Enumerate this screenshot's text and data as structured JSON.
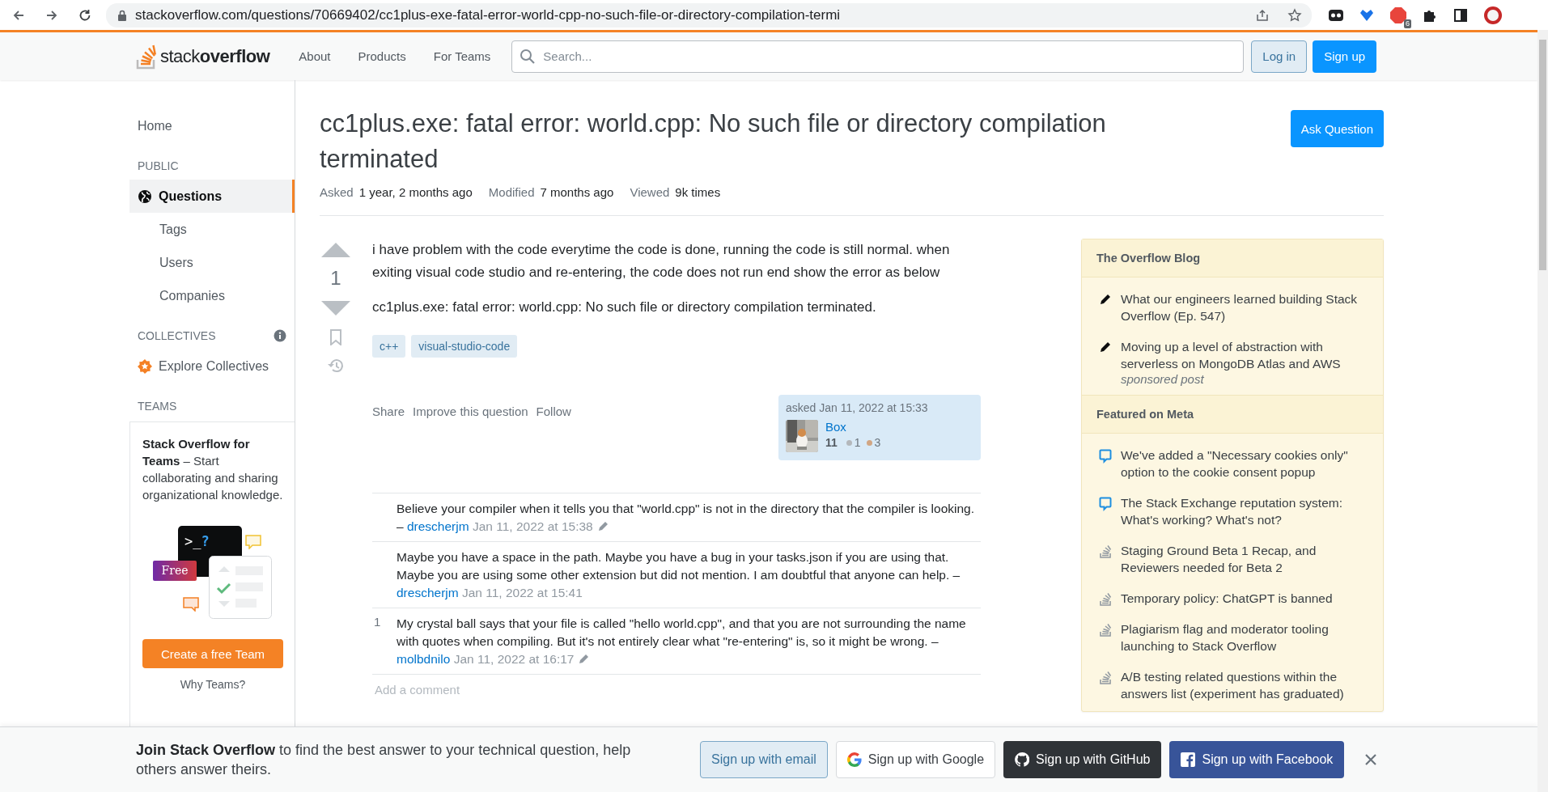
{
  "browser": {
    "url": "stackoverflow.com/questions/70669402/cc1plus-exe-fatal-error-world-cpp-no-such-file-or-directory-compilation-termi",
    "extension_badge": "6"
  },
  "header": {
    "logo": {
      "light": "stack",
      "bold": "overflow"
    },
    "nav": [
      "About",
      "Products",
      "For Teams"
    ],
    "search": {
      "placeholder": "Search..."
    },
    "buttons": [
      {
        "label": "Log in",
        "kind": "secondary"
      },
      {
        "label": "Sign up",
        "kind": "primary"
      }
    ]
  },
  "sidebar": {
    "items": [
      {
        "kind": "top",
        "label": "Home",
        "selected": false
      },
      {
        "kind": "heading",
        "label": "PUBLIC",
        "info": false
      },
      {
        "kind": "globe-link",
        "label": "Questions",
        "selected": true
      },
      {
        "kind": "sub",
        "label": "Tags",
        "selected": false
      },
      {
        "kind": "sub",
        "label": "Users",
        "selected": false
      },
      {
        "kind": "sub",
        "label": "Companies",
        "selected": false
      },
      {
        "kind": "heading",
        "label": "COLLECTIVES",
        "info": true
      },
      {
        "kind": "collective-link",
        "label": "Explore Collectives",
        "selected": false
      },
      {
        "kind": "heading",
        "label": "TEAMS",
        "info": false
      }
    ],
    "teams": {
      "text": "**Stack Overflow for Teams** – Start collaborating and sharing organizational knowledge.",
      "prompt": ">_",
      "prompt_mark": "?",
      "badge": "Free",
      "button": "Create a free Team",
      "link": "Why Teams?"
    }
  },
  "question": {
    "title": "cc1plus.exe: fatal error: world.cpp: No such file or directory compilation terminated",
    "ask_button": "Ask Question",
    "meta": [
      {
        "label": "Asked",
        "value": "1 year, 2 months ago"
      },
      {
        "label": "Modified",
        "value": "7 months ago"
      },
      {
        "label": "Viewed",
        "value": "9k times"
      }
    ],
    "votes": "1",
    "body": [
      "i have problem with the code everytime the code is done, running the code is still normal. when exiting visual code studio and re-entering, the code does not run end show the error as below",
      "cc1plus.exe: fatal error: world.cpp: No such file or directory compilation terminated."
    ],
    "tags": [
      "c++",
      "visual-studio-code"
    ],
    "actions": [
      "Share",
      "Improve this question",
      "Follow"
    ],
    "owner": {
      "action": "asked Jan 11, 2022 at 15:33",
      "name": "Box",
      "reputation": "11",
      "badges": [
        {
          "count": "1",
          "color": "#b4b8bc"
        },
        {
          "count": "3",
          "color": "#d1a684"
        }
      ]
    },
    "comments": [
      {
        "text": "Believe your compiler when it tells you that \"world.cpp\" is not in the directory that the compiler is looking.",
        "dash": "–",
        "author": "drescherjm",
        "date": "Jan 11, 2022 at 15:38",
        "edited": true
      },
      {
        "text": "Maybe you have a space in the path. Maybe you have a bug in your tasks.json if you are using that. Maybe you are using some other extension but did not mention. I am doubtful that anyone can help.",
        "dash": "–",
        "author": "drescherjm",
        "date": "Jan 11, 2022 at 15:41",
        "edited": false
      },
      {
        "score": "1",
        "text": "My crystal ball says that your file is called \"hello world.cpp\", and that you are not surrounding the name with quotes when compiling. But it's not entirely clear what \"re-entering\" is, so it might be wrong.",
        "dash": "–",
        "author": "molbdnilo",
        "date": "Jan 11, 2022 at 16:17",
        "edited": true
      }
    ],
    "add_comment": "Add a comment"
  },
  "right_sidebar": [
    {
      "title": "The Overflow Blog",
      "items": [
        {
          "kind": "pencil",
          "text": "What our engineers learned building Stack Overflow (Ep. 547)"
        },
        {
          "kind": "pencil",
          "text": "Moving up a level of abstraction with serverless on MongoDB Atlas and AWS",
          "note": "sponsored post"
        }
      ]
    },
    {
      "title": "Featured on Meta",
      "items": [
        {
          "kind": "chat",
          "text": "We've added a \"Necessary cookies only\" option to the cookie consent popup"
        },
        {
          "kind": "chat",
          "text": "The Stack Exchange reputation system: What's working? What's not?"
        },
        {
          "kind": "stack",
          "text": "Staging Ground Beta 1 Recap, and Reviewers needed for Beta 2"
        },
        {
          "kind": "stack",
          "text": "Temporary policy: ChatGPT is banned"
        },
        {
          "kind": "stack",
          "text": "Plagiarism flag and moderator tooling launching to Stack Overflow"
        },
        {
          "kind": "stack",
          "text": "A/B testing related questions within the answers list (experiment has graduated)"
        }
      ]
    }
  ],
  "signup_banner": {
    "text": "**Join Stack Overflow** to find the best answer to your technical question, help others answer theirs.",
    "buttons": [
      {
        "kind": "email",
        "label": "Sign up with email"
      },
      {
        "kind": "google",
        "label": "Sign up with Google"
      },
      {
        "kind": "github",
        "label": "Sign up with GitHub"
      },
      {
        "kind": "facebook",
        "label": "Sign up with Facebook"
      }
    ]
  }
}
